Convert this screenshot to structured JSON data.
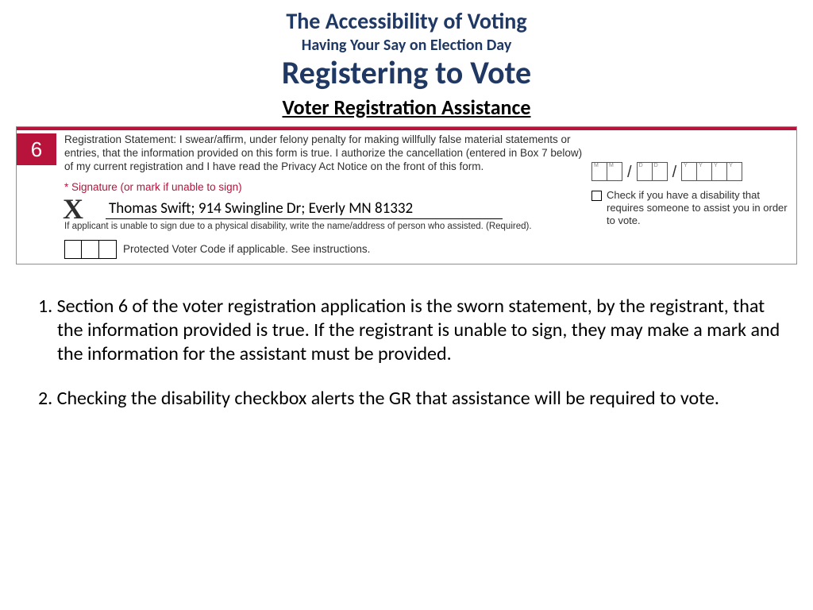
{
  "titles": {
    "t1": "The Accessibility of Voting",
    "t2": "Having Your Say on Election Day",
    "t3": "Registering to Vote",
    "t4": "Voter Registration Assistance"
  },
  "form": {
    "section_number": "6",
    "statement": "Registration Statement: I swear/affirm, under felony penalty for making willfully false material statements or entries, that the information provided on this form is true. I authorize the cancellation (entered in Box 7 below) of my current registration and I have read the Privacy Act Notice on the front of this form.",
    "signature_label_prefix": "* Signature",
    "signature_label_suffix": " (or mark if unable to sign)",
    "x_mark": "X",
    "signature_value": "Thomas Swift; 914 Swingline Dr; Everly MN 81332",
    "signature_note": "If applicant is unable to sign due to a physical disability, write the name/address of person who assisted. (Required).",
    "pvc_label": "Protected Voter Code if applicable. See instructions.",
    "date_hints": [
      "M",
      "M",
      "D",
      "D",
      "Y",
      "Y",
      "Y",
      "Y"
    ],
    "disability_text": "Check if you have a disability that requires someone to assist you in order to vote."
  },
  "body": {
    "p1": "1. Section 6 of the voter registration application is the sworn statement, by the registrant, that the information provided is true. If the registrant is unable to sign, they may make a mark and the information for the assistant must be provided.",
    "p2": "2. Checking the disability checkbox alerts the GR that assistance will be required to vote."
  }
}
